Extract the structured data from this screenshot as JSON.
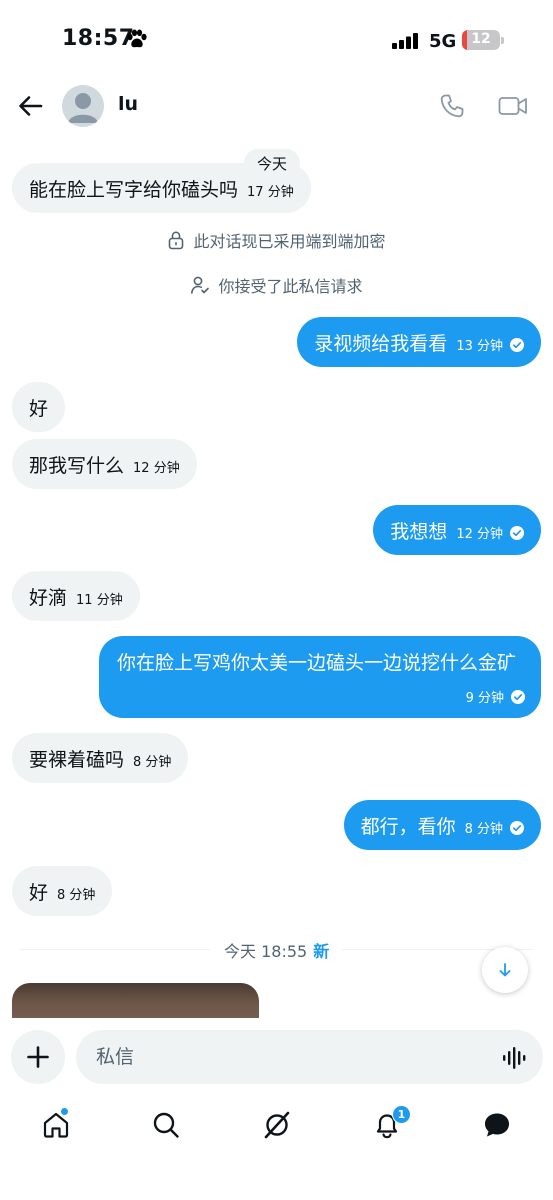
{
  "status_bar": {
    "time": "18:57",
    "network": "5G",
    "battery_level": "12",
    "battery_fraction": 0.12
  },
  "header": {
    "contact_name": "lu",
    "icons": [
      "back-arrow-icon",
      "avatar",
      "phone-icon",
      "video-camera-icon"
    ]
  },
  "conversation": {
    "date_chip": "今天",
    "system_notices": {
      "encryption": "此对话现已采用端到端加密",
      "accepted_request": "你接受了此私信请求"
    },
    "messages": [
      {
        "dir": "in",
        "text": "能在脸上写字给你磕头吗",
        "time": "17 分钟"
      },
      {
        "dir": "out",
        "text": "录视频给我看看",
        "time": "13 分钟"
      },
      {
        "dir": "in",
        "text": "好",
        "time": ""
      },
      {
        "dir": "in",
        "text": "那我写什么",
        "time": "12 分钟"
      },
      {
        "dir": "out",
        "text": "我想想",
        "time": "12 分钟"
      },
      {
        "dir": "in",
        "text": "好滴",
        "time": "11 分钟"
      },
      {
        "dir": "out",
        "text": "你在脸上写鸡你太美一边磕头一边说挖什么金矿",
        "time": "9 分钟"
      },
      {
        "dir": "in",
        "text": "要裸着磕吗",
        "time": "8 分钟"
      },
      {
        "dir": "out",
        "text": "都行，看你",
        "time": "8 分钟"
      },
      {
        "dir": "in",
        "text": "好",
        "time": "8 分钟"
      }
    ],
    "new_divider": {
      "label": "今天 18:55",
      "new_label": "新"
    }
  },
  "composer": {
    "placeholder": "私信"
  },
  "bottom_nav": {
    "items": [
      "home-icon",
      "search-icon",
      "grok-icon",
      "notifications-icon",
      "messages-icon"
    ],
    "notifications_count": "1"
  },
  "colors": {
    "accent": "#1d9bf0",
    "incoming_bubble": "#eff3f4",
    "secondary_text": "#536471",
    "battery_low": "#e9473f"
  }
}
